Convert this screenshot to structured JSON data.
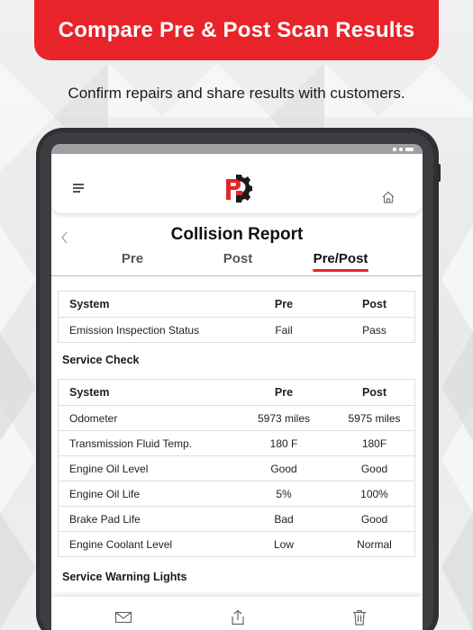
{
  "banner": {
    "title": "Compare Pre & Post Scan Results"
  },
  "subtitle": "Confirm repairs and share results with customers.",
  "colors": {
    "brand_red": "#e8232a",
    "text_dark": "#111111",
    "divider": "#dedede"
  },
  "app_bar": {
    "menu_icon": "hamburger-menu-icon",
    "logo_icon": "pro-gear-logo",
    "home_icon": "home-icon"
  },
  "report": {
    "title": "Collision Report",
    "back_icon": "chevron-left-icon",
    "tabs": [
      {
        "label": "Pre",
        "active": false
      },
      {
        "label": "Post",
        "active": false
      },
      {
        "label": "Pre/Post",
        "active": true
      }
    ]
  },
  "emission_table": {
    "headers": [
      "System",
      "Pre",
      "Post"
    ],
    "rows": [
      [
        "Emission Inspection Status",
        "Fail",
        "Pass"
      ]
    ]
  },
  "service_check": {
    "label": "Service Check",
    "headers": [
      "System",
      "Pre",
      "Post"
    ],
    "rows": [
      [
        "Odometer",
        "5973 miles",
        "5975 miles"
      ],
      [
        "Transmission Fluid Temp.",
        "180 F",
        "180F"
      ],
      [
        "Engine Oil Level",
        "Good",
        "Good"
      ],
      [
        "Engine Oil Life",
        "5%",
        "100%"
      ],
      [
        "Brake Pad Life",
        "Bad",
        "Good"
      ],
      [
        "Engine Coolant Level",
        "Low",
        "Normal"
      ]
    ]
  },
  "service_warning": {
    "label": "Service Warning Lights"
  },
  "bottom_bar": {
    "icons": [
      "mail-icon",
      "share-icon",
      "trash-icon"
    ]
  }
}
